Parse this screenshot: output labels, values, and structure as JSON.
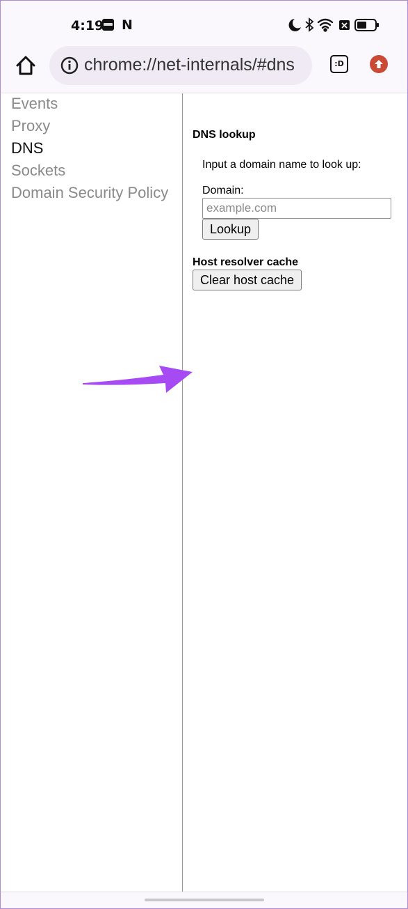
{
  "status_bar": {
    "time": "4:19",
    "notification_icons": [
      "news-icon",
      "netflix-icon"
    ],
    "netflix_glyph": "N",
    "system_icons": [
      "moon-icon",
      "bluetooth-icon",
      "wifi-icon",
      "no-sim-icon",
      "battery-icon"
    ]
  },
  "browser": {
    "url": "chrome://net-internals/#dns",
    "tab_count_label": ":D",
    "icons": [
      "home-icon",
      "info-icon",
      "tabs-icon",
      "update-icon"
    ],
    "update_color": "#c94a35"
  },
  "sidebar": {
    "items": [
      {
        "label": "Events",
        "active": false
      },
      {
        "label": "Proxy",
        "active": false
      },
      {
        "label": "DNS",
        "active": true
      },
      {
        "label": "Sockets",
        "active": false
      },
      {
        "label": "Domain Security Policy",
        "active": false
      }
    ]
  },
  "dns": {
    "lookup_title": "DNS lookup",
    "lookup_prompt": "Input a domain name to look up:",
    "domain_label": "Domain:",
    "domain_placeholder": "example.com",
    "domain_value": "",
    "lookup_button": "Lookup",
    "cache_title": "Host resolver cache",
    "clear_cache_button": "Clear host cache"
  },
  "annotation": {
    "arrow_color": "#a64bf4",
    "points_to": "clear-host-cache-button"
  },
  "frame_border_color": "#b18ad6"
}
